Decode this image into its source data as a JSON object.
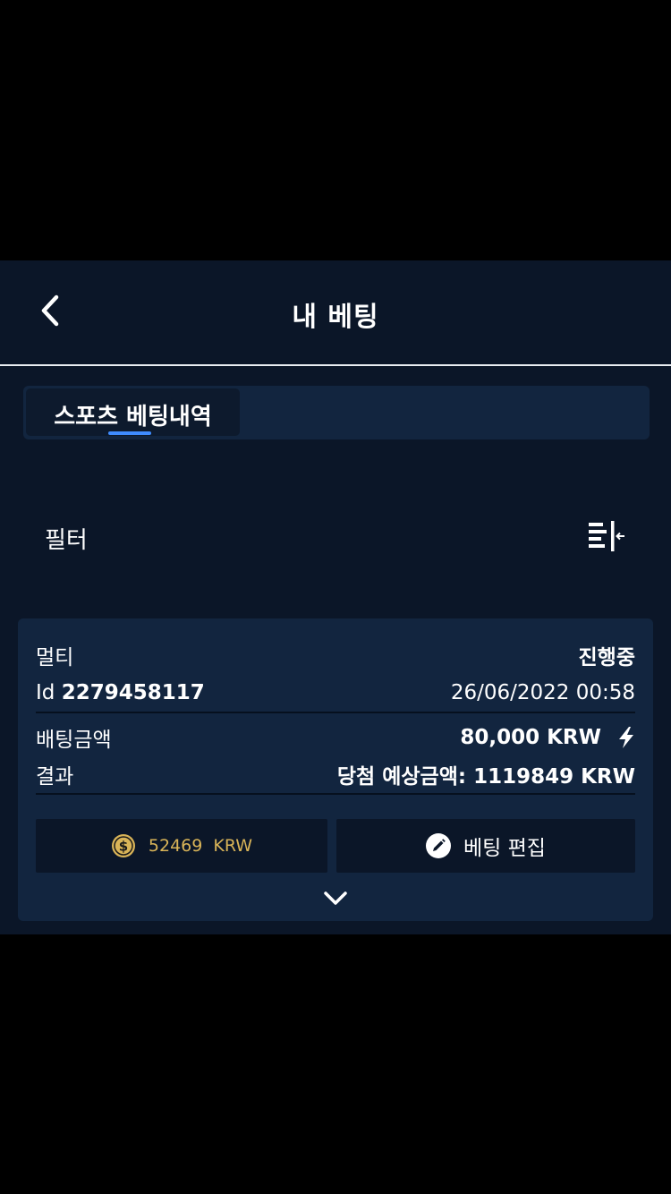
{
  "header": {
    "title": "내 베팅"
  },
  "tabs": [
    {
      "label": "스포츠 베팅내역"
    }
  ],
  "filter": {
    "label": "필터"
  },
  "bet": {
    "type": "멀티",
    "status": "진행중",
    "id_label": "Id",
    "id_value": "2279458117",
    "datetime": "26/06/2022 00:58",
    "stake_label": "배팅금액",
    "stake_value": "80,000 KRW",
    "result_label": "결과",
    "result_value": "당첨 예상금액: 1119849 KRW",
    "balance": "52469  KRW",
    "edit_label": "베팅 편집"
  },
  "colors": {
    "background": "#0b1628",
    "card": "#12253f",
    "accent": "#3f8cff",
    "gold": "#d9b458"
  }
}
